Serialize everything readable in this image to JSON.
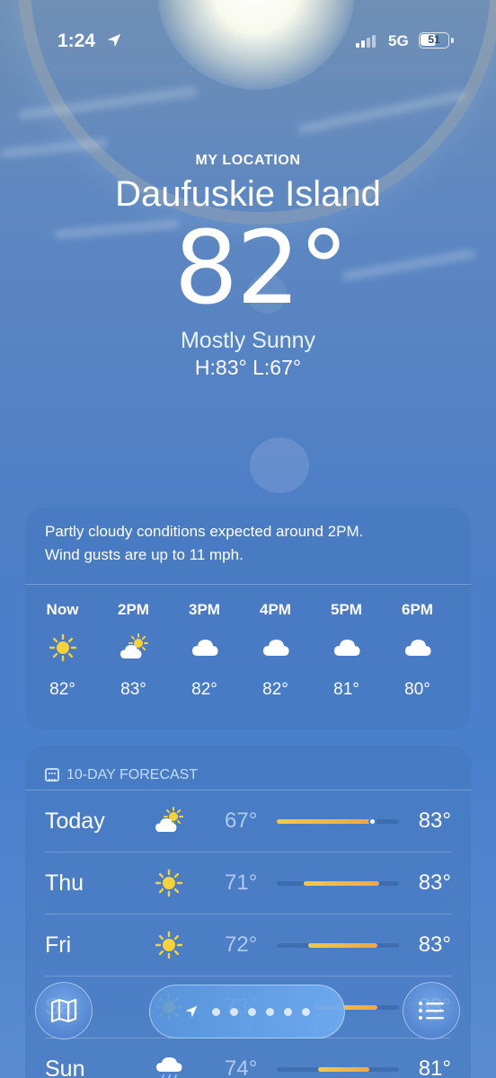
{
  "status_bar": {
    "time": "1:24",
    "network": "5G",
    "battery": "51"
  },
  "location": {
    "label": "MY LOCATION",
    "city": "Daufuskie Island",
    "temperature": "82°",
    "condition": "Mostly Sunny",
    "high_low": "H:83°  L:67°"
  },
  "hourly": {
    "summary_line1": "Partly cloudy conditions expected around 2PM.",
    "summary_line2": "Wind gusts are up to 11 mph.",
    "items": [
      {
        "time": "Now",
        "icon": "sun-icon",
        "temp": "82°"
      },
      {
        "time": "2PM",
        "icon": "partly-cloudy-icon",
        "temp": "83°"
      },
      {
        "time": "3PM",
        "icon": "cloud-icon",
        "temp": "82°"
      },
      {
        "time": "4PM",
        "icon": "cloud-icon",
        "temp": "82°"
      },
      {
        "time": "5PM",
        "icon": "cloud-icon",
        "temp": "81°"
      },
      {
        "time": "6PM",
        "icon": "cloud-icon",
        "temp": "80°"
      }
    ]
  },
  "forecast": {
    "header": "10-DAY FORECAST",
    "days": [
      {
        "day": "Today",
        "icon": "partly-cloudy-icon",
        "low": "67°",
        "high": "83°",
        "range_start": 0.0,
        "range_end": 0.78,
        "current": 0.78
      },
      {
        "day": "Thu",
        "icon": "sun-icon",
        "low": "71°",
        "high": "83°",
        "range_start": 0.22,
        "range_end": 0.84
      },
      {
        "day": "Fri",
        "icon": "sun-icon",
        "low": "72°",
        "high": "83°",
        "range_start": 0.26,
        "range_end": 0.82
      },
      {
        "day": "Sat",
        "icon": "sun-icon",
        "low": "73°",
        "high": "83°",
        "range_start": 0.3,
        "range_end": 0.82
      },
      {
        "day": "Sun",
        "icon": "rain-icon",
        "low": "74°",
        "high": "81°",
        "range_start": 0.34,
        "range_end": 0.76
      }
    ]
  },
  "colors": {
    "sun": "#f7d13b",
    "range_bar_start": "#f1c94a",
    "range_bar_end": "#f0a64a"
  }
}
